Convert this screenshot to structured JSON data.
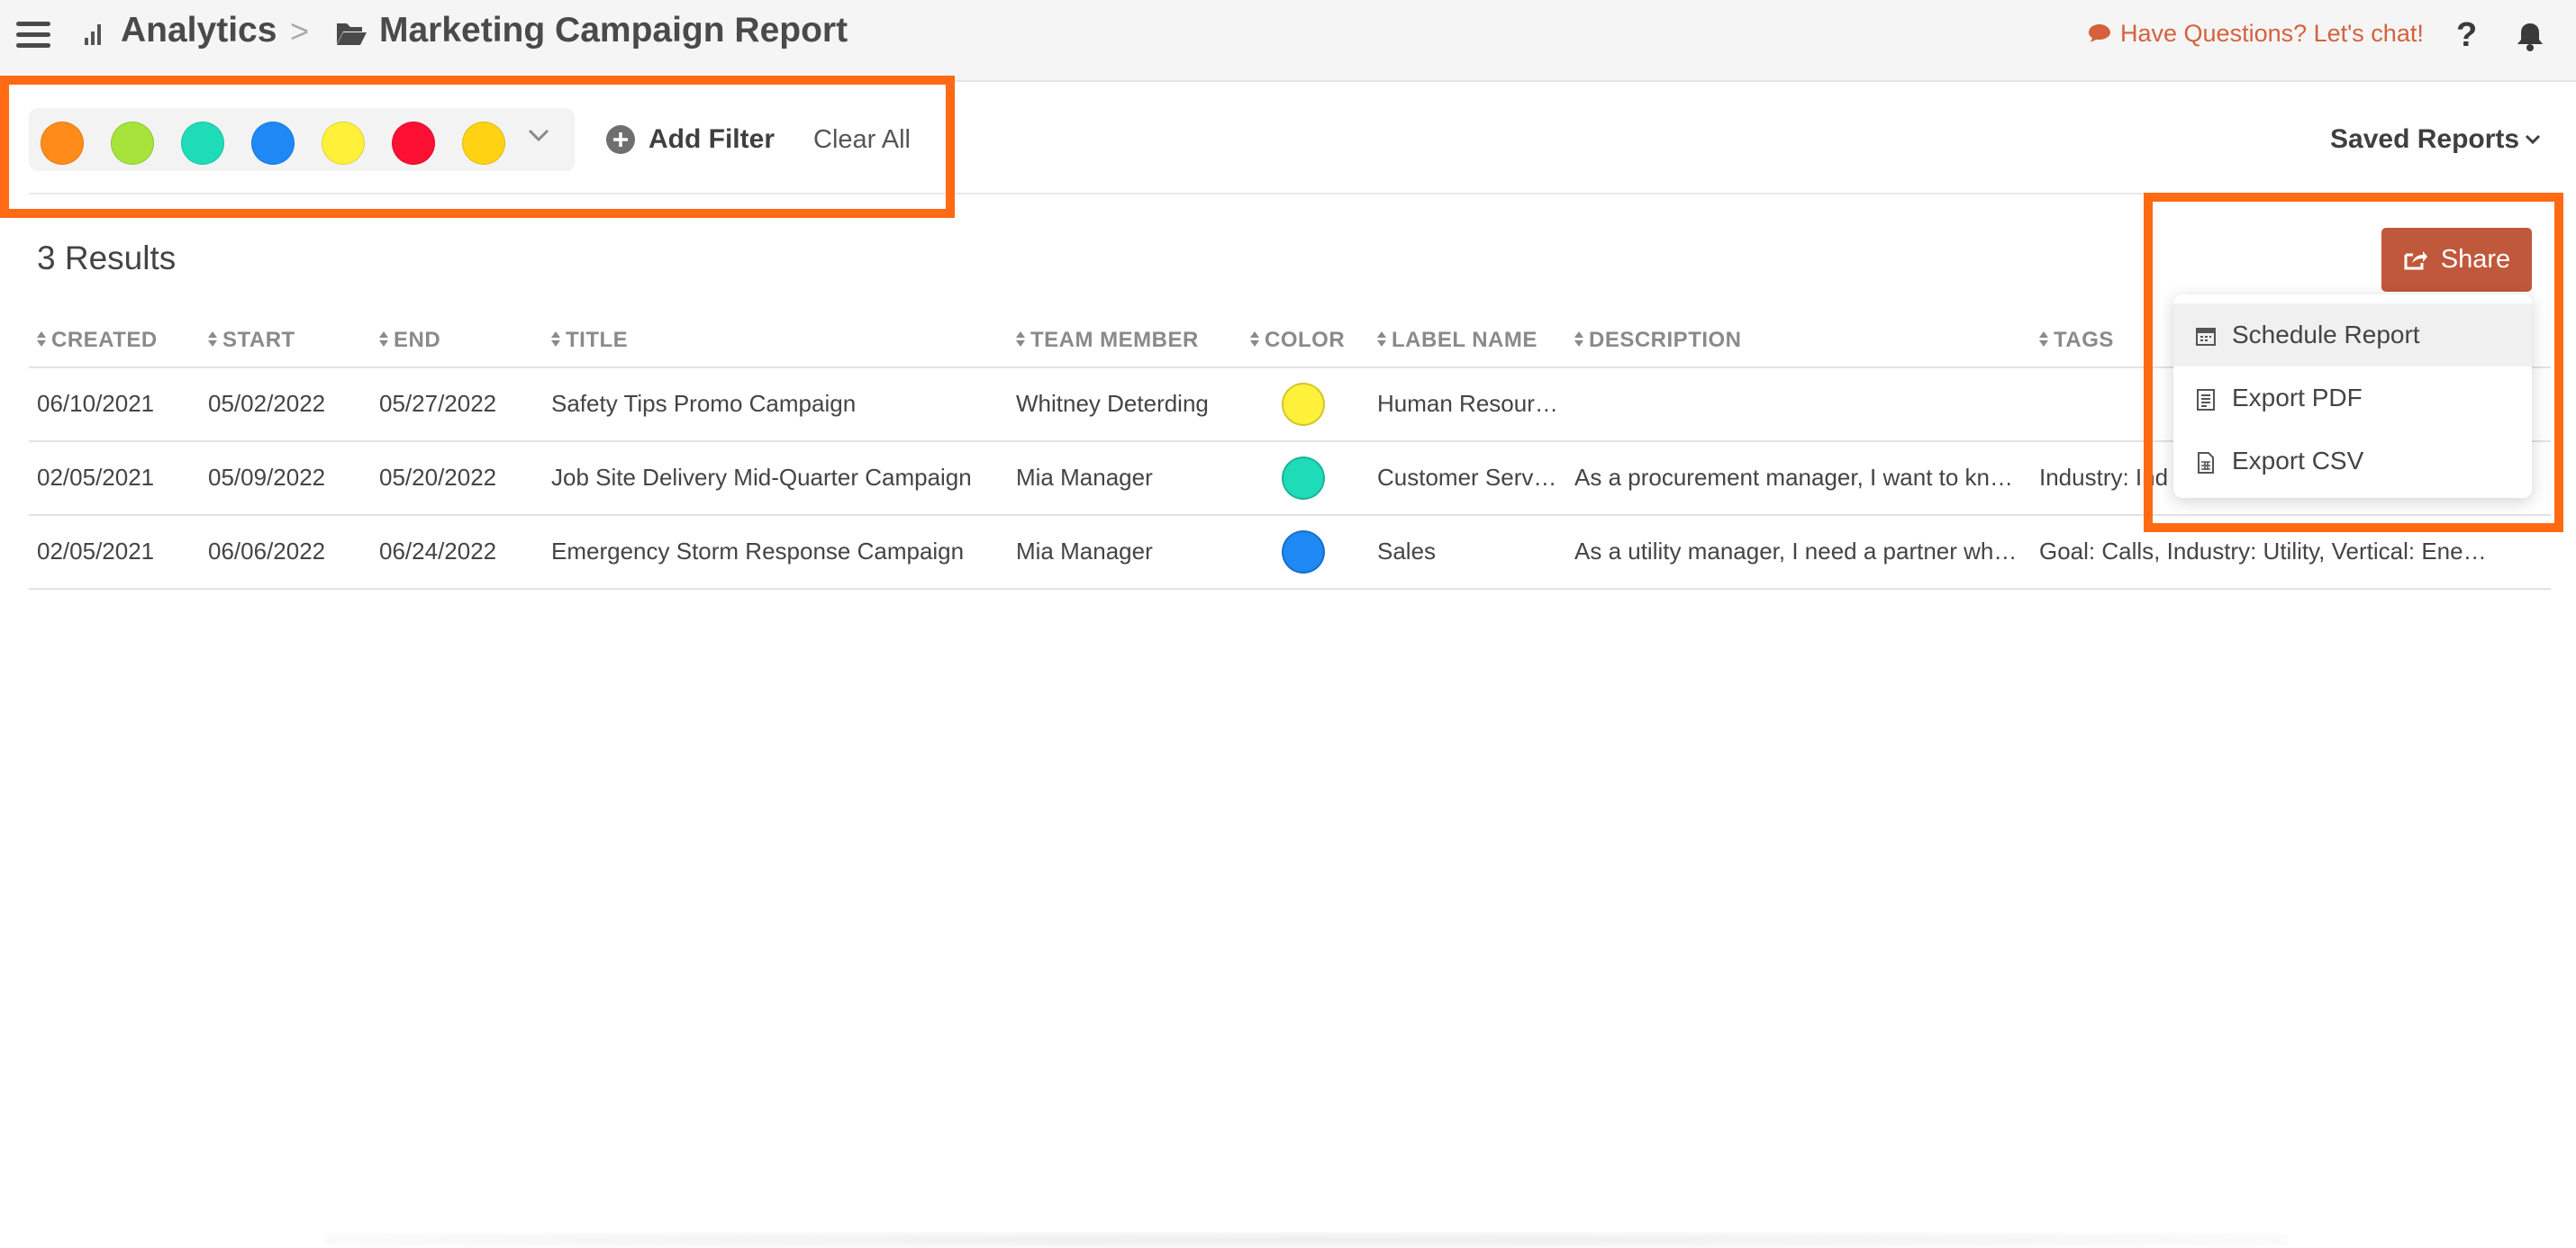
{
  "header": {
    "breadcrumb_root": "Analytics",
    "breadcrumb_separator": ">",
    "page_title": "Marketing Campaign Report",
    "chat_link": "Have Questions? Let's chat!",
    "help_label": "?"
  },
  "filters": {
    "color_swatches": [
      "#ff8c1a",
      "#a6e33b",
      "#1fdcb9",
      "#1e88f5",
      "#fff139",
      "#fb0f33",
      "#ffd314"
    ],
    "add_filter_label": "Add Filter",
    "clear_all_label": "Clear All",
    "saved_reports_label": "Saved Reports"
  },
  "results": {
    "count_label": "3 Results",
    "share_label": "Share"
  },
  "share_menu": {
    "items": [
      {
        "label": "Schedule Report",
        "icon": "calendar-icon"
      },
      {
        "label": "Export PDF",
        "icon": "document-icon"
      },
      {
        "label": "Export CSV",
        "icon": "spreadsheet-icon"
      }
    ]
  },
  "table": {
    "columns": [
      "CREATED",
      "START",
      "END",
      "TITLE",
      "TEAM MEMBER",
      "COLOR",
      "LABEL NAME",
      "DESCRIPTION",
      "TAGS"
    ],
    "rows": [
      {
        "created": "06/10/2021",
        "start": "05/02/2022",
        "end": "05/27/2022",
        "title": "Safety Tips Promo Campaign",
        "team_member": "Whitney Deterding",
        "color": "#fff139",
        "label_name": "Human Resour…",
        "description": "",
        "tags": ""
      },
      {
        "created": "02/05/2021",
        "start": "05/09/2022",
        "end": "05/20/2022",
        "title": "Job Site Delivery Mid-Quarter Campaign",
        "team_member": "Mia Manager",
        "color": "#1fdcb9",
        "label_name": "Customer Serv…",
        "description": "As a procurement manager, I want to kn…",
        "tags": "Industry: Ind"
      },
      {
        "created": "02/05/2021",
        "start": "06/06/2022",
        "end": "06/24/2022",
        "title": "Emergency Storm Response Campaign",
        "team_member": "Mia Manager",
        "color": "#1e88f5",
        "label_name": "Sales",
        "description": "As a utility manager, I need a partner wh…",
        "tags": "Goal: Calls, Industry: Utility, Vertical: Ene…"
      }
    ]
  },
  "colors": {
    "accent": "#c0583b",
    "highlight": "#ff6a13",
    "chat_text": "#d5613c"
  }
}
